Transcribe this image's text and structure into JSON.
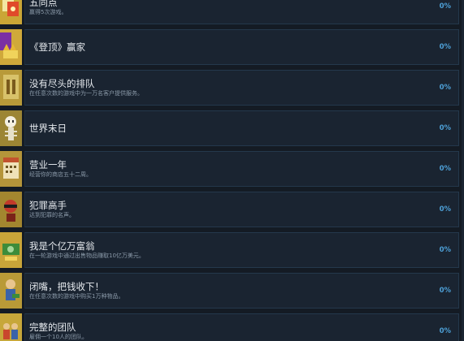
{
  "achievements": [
    {
      "title": "五同点",
      "desc": "赢得5次游戏。",
      "percent": "0%",
      "icon": "achievement-icon-five-of-a-kind",
      "has_icon": true
    },
    {
      "title": "《登顶》赢家",
      "desc": "",
      "percent": "0%",
      "icon": "achievement-icon-top-winner",
      "has_icon": true
    },
    {
      "title": "没有尽头的排队",
      "desc": "在任意次数的游戏中为一万名客户提供服务。",
      "percent": "0%",
      "icon": "achievement-icon-endless-queue",
      "has_icon": true
    },
    {
      "title": "世界末日",
      "desc": "",
      "percent": "0%",
      "icon": "achievement-icon-skeleton",
      "has_icon": true
    },
    {
      "title": "营业一年",
      "desc": "经营你的商店五十二周。",
      "percent": "0%",
      "icon": "achievement-icon-one-year",
      "has_icon": true
    },
    {
      "title": "犯罪高手",
      "desc": "达到犯罪的名声。",
      "percent": "0%",
      "icon": "achievement-icon-crime-master",
      "has_icon": true
    },
    {
      "title": "我是个亿万富翁",
      "desc": "在一轮游戏中通过出售物品赚取10亿万美元。",
      "percent": "0%",
      "icon": "achievement-icon-billionaire",
      "has_icon": true
    },
    {
      "title": "闭嘴，把钱收下！",
      "desc": "在任意次数的游戏中购买1万种物品。",
      "percent": "0%",
      "icon": "achievement-icon-take-money",
      "has_icon": true
    },
    {
      "title": "完整的团队",
      "desc": "雇佣一个10人的团队。",
      "percent": "0%",
      "icon": "achievement-icon-full-team",
      "has_icon": true
    }
  ],
  "colors": {
    "background": "#141b24",
    "panel": "#1a2431",
    "border": "#24384c",
    "title": "#e6eaee",
    "desc": "#8a99a8",
    "percent": "#4d9fd6",
    "icon_gold": "#a8892a"
  }
}
